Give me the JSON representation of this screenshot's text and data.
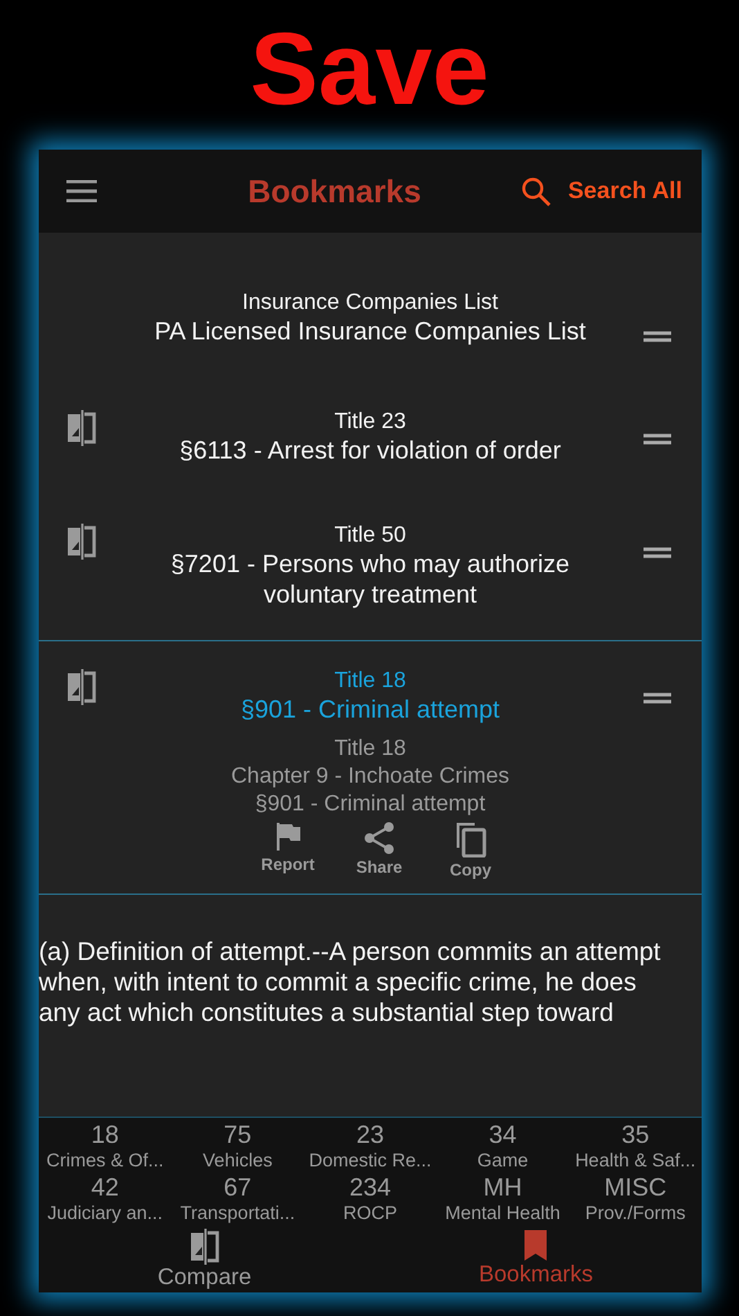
{
  "headline": "Save",
  "header": {
    "title": "Bookmarks",
    "search_label": "Search All"
  },
  "bookmarks": [
    {
      "heading": "Insurance Companies List",
      "title": "PA Licensed Insurance Companies List",
      "compare": false,
      "selected": false,
      "expanded": false
    },
    {
      "heading": "Title 23",
      "title": "§6113 - Arrest for violation of order",
      "compare": true,
      "selected": false,
      "expanded": false
    },
    {
      "heading": "Title 50",
      "title": "§7201 - Persons who may authorize voluntary treatment",
      "compare": true,
      "selected": false,
      "expanded": false
    },
    {
      "heading": "Title 18",
      "title": "§901 - Criminal attempt",
      "compare": true,
      "selected": true,
      "expanded": true,
      "details": [
        "Title 18",
        "Chapter 9 - Inchoate Crimes",
        "§901 - Criminal attempt"
      ],
      "actions": [
        {
          "kind": "report",
          "label": "Report"
        },
        {
          "kind": "share",
          "label": "Share"
        },
        {
          "kind": "copy",
          "label": "Copy"
        }
      ]
    }
  ],
  "content": [
    "(a)  Definition of attempt.--A person commits an attempt when, with intent to commit a specific crime, he does",
    "any act which constitutes a substantial step toward"
  ],
  "categories": [
    {
      "code": "18",
      "label": "Crimes & Of..."
    },
    {
      "code": "75",
      "label": "Vehicles"
    },
    {
      "code": "23",
      "label": "Domestic Re..."
    },
    {
      "code": "34",
      "label": "Game"
    },
    {
      "code": "35",
      "label": "Health & Saf..."
    },
    {
      "code": "42",
      "label": "Judiciary an..."
    },
    {
      "code": "67",
      "label": "Transportati..."
    },
    {
      "code": "234",
      "label": "ROCP"
    },
    {
      "code": "MH",
      "label": "Mental Health"
    },
    {
      "code": "MISC",
      "label": "Prov./Forms"
    }
  ],
  "tabs": [
    {
      "kind": "compare",
      "label": "Compare",
      "selected": false
    },
    {
      "kind": "bookmark",
      "label": "Bookmarks",
      "selected": true
    }
  ]
}
